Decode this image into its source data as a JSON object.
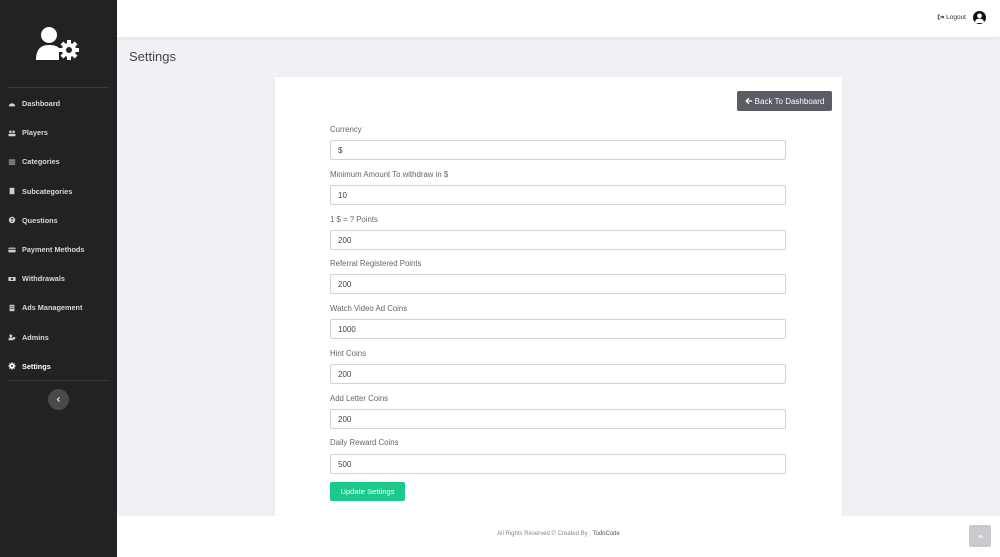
{
  "page": {
    "title": "Settings"
  },
  "topbar": {
    "logout_label": "Logout"
  },
  "sidebar": {
    "items": [
      {
        "label": "Dashboard",
        "icon": "dashboard-icon"
      },
      {
        "label": "Players",
        "icon": "users-icon"
      },
      {
        "label": "Categories",
        "icon": "list-icon"
      },
      {
        "label": "Subcategories",
        "icon": "file-icon"
      },
      {
        "label": "Questions",
        "icon": "question-icon"
      },
      {
        "label": "Payment Methods",
        "icon": "credit-card-icon"
      },
      {
        "label": "Withdrawals",
        "icon": "money-icon"
      },
      {
        "label": "Ads Management",
        "icon": "ad-icon"
      },
      {
        "label": "Admins",
        "icon": "admins-icon"
      },
      {
        "label": "Settings",
        "icon": "gear-icon",
        "active": true
      }
    ]
  },
  "card": {
    "back_label": "Back To Dashboard",
    "fields": [
      {
        "label": "Currency",
        "value": "$"
      },
      {
        "label": "Minimum Amount To withdraw in $",
        "value": "10"
      },
      {
        "label": "1 $ = ? Points",
        "value": "200"
      },
      {
        "label": "Referral Registered Points",
        "value": "200"
      },
      {
        "label": "Watch Video Ad Coins",
        "value": "1000"
      },
      {
        "label": "Hint Coins",
        "value": "200"
      },
      {
        "label": "Add Letter Coins",
        "value": "200"
      },
      {
        "label": "Daily Reward Coins",
        "value": "500"
      }
    ],
    "submit_label": "Update Settings"
  },
  "footer": {
    "text": "All Rights Reserved © Created By : ",
    "brand": "TodoCode"
  },
  "colors": {
    "sidebar": "#222222",
    "accent": "#1cc88a",
    "back_button": "#5a5d63"
  }
}
